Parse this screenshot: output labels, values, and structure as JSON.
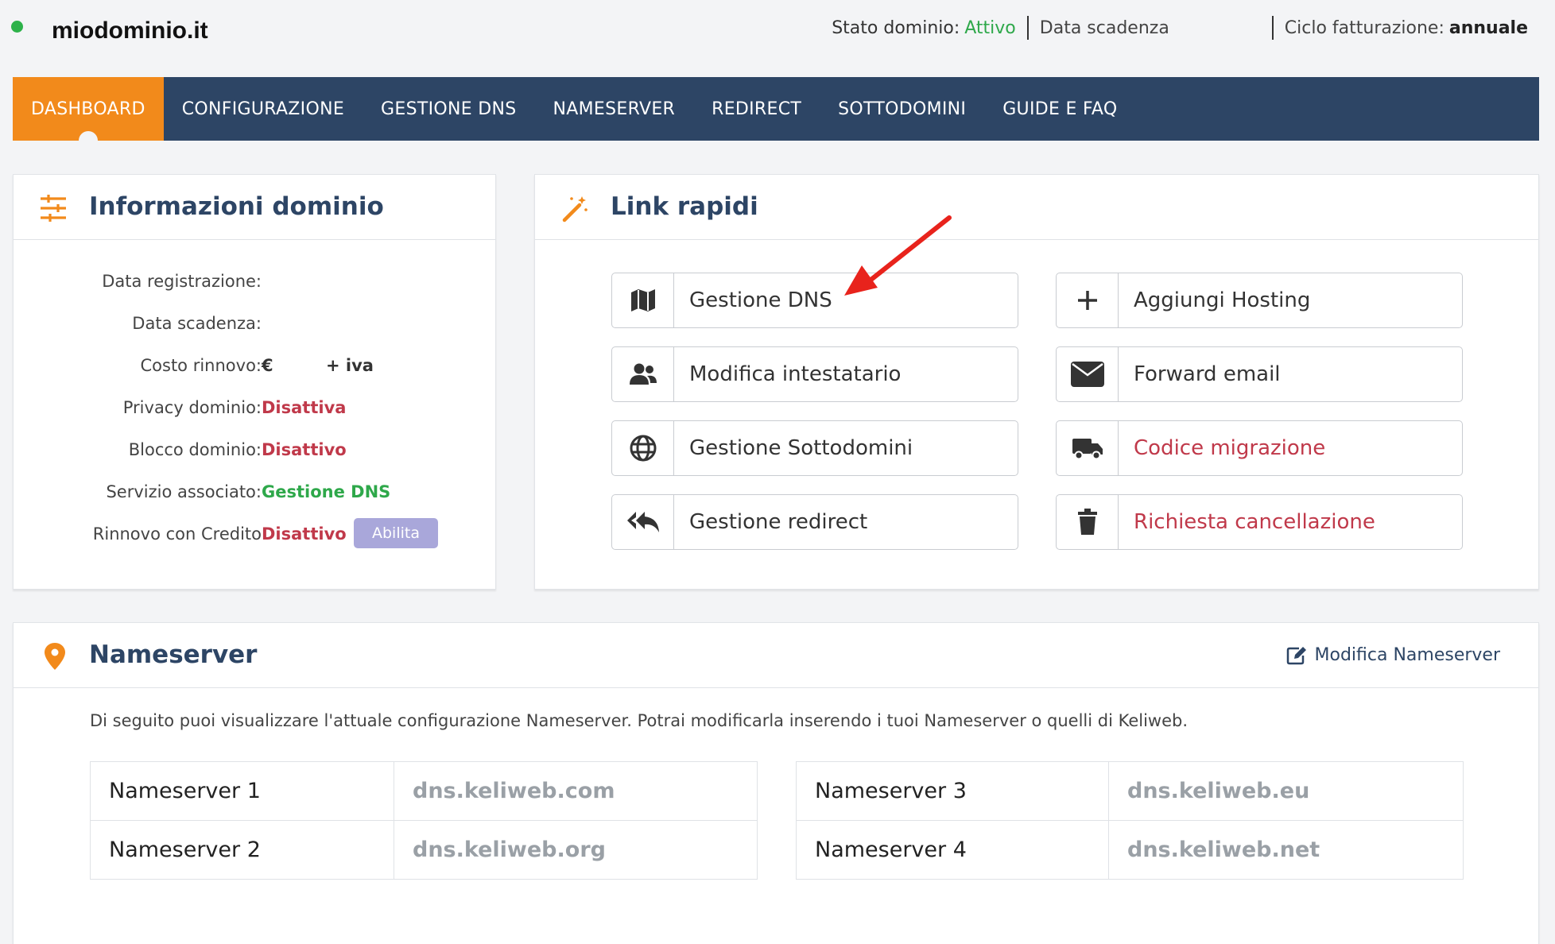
{
  "header": {
    "domain": "miodominio.it",
    "status_label": "Stato dominio:",
    "status_value": "Attivo",
    "expiry_label": "Data scadenza",
    "billing_label": "Ciclo fatturazione:",
    "billing_value": "annuale"
  },
  "nav": {
    "items": [
      {
        "label": "DASHBOARD"
      },
      {
        "label": "CONFIGURAZIONE"
      },
      {
        "label": "GESTIONE DNS"
      },
      {
        "label": "NAMESERVER"
      },
      {
        "label": "REDIRECT"
      },
      {
        "label": "SOTTODOMINI"
      },
      {
        "label": "GUIDE E FAQ"
      }
    ]
  },
  "info": {
    "title": "Informazioni dominio",
    "rows": [
      {
        "label": "Data registrazione:",
        "value": ""
      },
      {
        "label": "Data scadenza:",
        "value": ""
      },
      {
        "label": "Costo rinnovo:",
        "value": "€",
        "suffix": "+ iva"
      },
      {
        "label": "Privacy dominio:",
        "value": "Disattiva"
      },
      {
        "label": "Blocco dominio:",
        "value": "Disattivo"
      },
      {
        "label": "Servizio associato:",
        "value": "Gestione DNS"
      },
      {
        "label": "Rinnovo con Credito",
        "value": "Disattivo",
        "button": "Abilita"
      }
    ]
  },
  "links": {
    "title": "Link rapidi",
    "items": [
      {
        "label": "Gestione DNS",
        "icon": "map-icon"
      },
      {
        "label": "Aggiungi Hosting",
        "icon": "plus-icon"
      },
      {
        "label": "Modifica intestatario",
        "icon": "users-icon"
      },
      {
        "label": "Forward email",
        "icon": "envelope-icon"
      },
      {
        "label": "Gestione Sottodomini",
        "icon": "globe-icon"
      },
      {
        "label": "Codice migrazione",
        "icon": "truck-icon"
      },
      {
        "label": "Gestione redirect",
        "icon": "reply-all-icon"
      },
      {
        "label": "Richiesta cancellazione",
        "icon": "trash-icon"
      }
    ]
  },
  "nameserver": {
    "title": "Nameserver",
    "edit_label": "Modifica Nameserver",
    "description": "Di seguito puoi visualizzare l'attuale configurazione Nameserver. Potrai modificarla inserendo i tuoi Nameserver o quelli di Keliweb.",
    "entries": [
      {
        "label": "Nameserver 1",
        "value": "dns.keliweb.com"
      },
      {
        "label": "Nameserver 2",
        "value": "dns.keliweb.org"
      },
      {
        "label": "Nameserver 3",
        "value": "dns.keliweb.eu"
      },
      {
        "label": "Nameserver 4",
        "value": "dns.keliweb.net"
      }
    ]
  },
  "colors": {
    "accent": "#f28a1b",
    "nav": "#2d4565",
    "success": "#2ea84a",
    "danger": "#c0394a"
  }
}
